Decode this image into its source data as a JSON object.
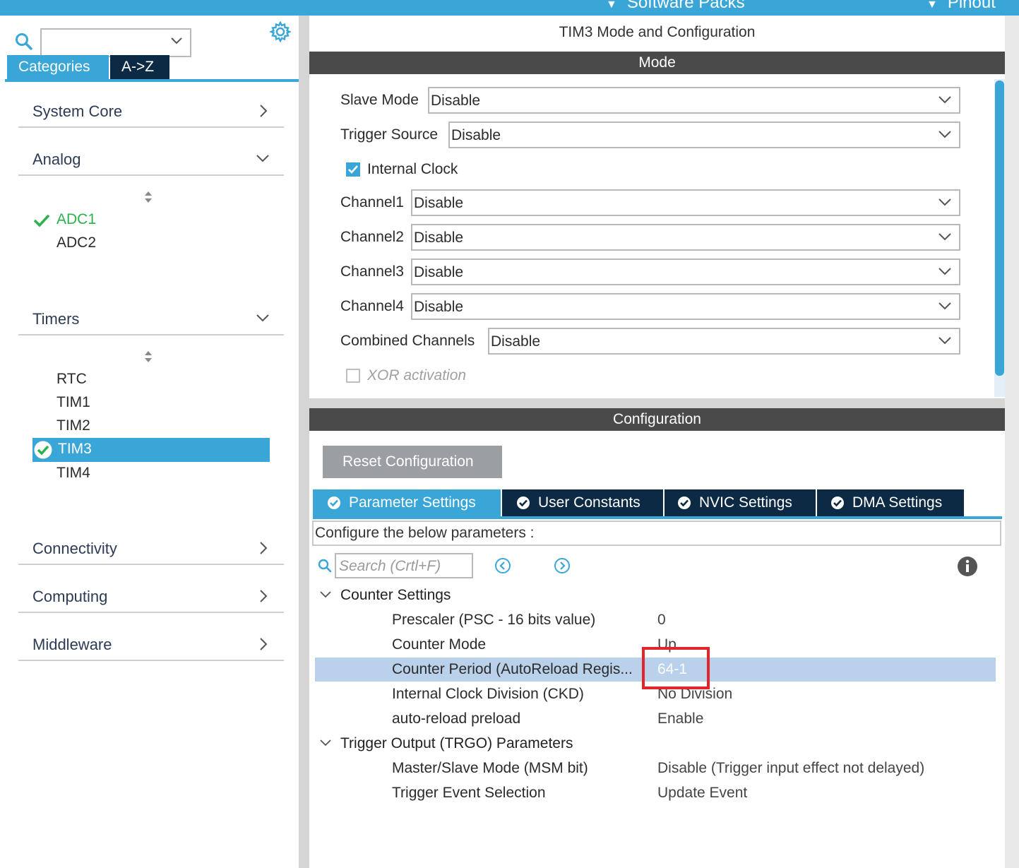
{
  "topbar": {
    "software_packs": "Software Packs",
    "pinout": "Pinout"
  },
  "left_panel": {
    "search": {
      "value": ""
    },
    "tabs": {
      "categories": "Categories",
      "az": "A->Z"
    },
    "categories": [
      {
        "label": "System Core",
        "state": "collapsed"
      },
      {
        "label": "Analog",
        "state": "expanded"
      },
      {
        "label": "Timers",
        "state": "expanded"
      },
      {
        "label": "Connectivity",
        "state": "collapsed"
      },
      {
        "label": "Computing",
        "state": "collapsed"
      },
      {
        "label": "Middleware",
        "state": "collapsed"
      }
    ],
    "analog_items": [
      "ADC1",
      "ADC2"
    ],
    "timer_items": [
      "RTC",
      "TIM1",
      "TIM2",
      "TIM3",
      "TIM4"
    ],
    "selected_item": "TIM3",
    "enabled_color": "#2bb24c",
    "accent": "#3aa6d8"
  },
  "right_panel": {
    "title": "TIM3 Mode and Configuration",
    "mode_header": "Mode",
    "mode_rows": [
      {
        "label": "Slave Mode",
        "value": "Disable"
      },
      {
        "label": "Trigger Source",
        "value": "Disable"
      },
      {
        "label": "Channel1",
        "value": "Disable"
      },
      {
        "label": "Channel2",
        "value": "Disable"
      },
      {
        "label": "Channel3",
        "value": "Disable"
      },
      {
        "label": "Channel4",
        "value": "Disable"
      },
      {
        "label": "Combined Channels",
        "value": "Disable"
      }
    ],
    "internal_clock": {
      "label": "Internal Clock",
      "checked": true
    },
    "xor_activation": {
      "label": "XOR activation",
      "checked": false,
      "disabled": true
    },
    "config_header": "Configuration",
    "reset_button": "Reset Configuration",
    "tabs": [
      {
        "label": "Parameter Settings",
        "active": true
      },
      {
        "label": "User Constants",
        "active": false
      },
      {
        "label": "NVIC Settings",
        "active": false
      },
      {
        "label": "DMA Settings",
        "active": false
      }
    ],
    "configure_text": "Configure the below parameters :",
    "search_placeholder": "Search (Crtl+F)",
    "groups": [
      {
        "label": "Counter Settings",
        "params": [
          {
            "name": "Prescaler (PSC - 16 bits value)",
            "value": "0"
          },
          {
            "name": "Counter Mode",
            "value": "Up"
          },
          {
            "name": "Counter Period (AutoReload Regis...",
            "value": "64-1"
          },
          {
            "name": "Internal Clock Division (CKD)",
            "value": "No Division"
          },
          {
            "name": "auto-reload preload",
            "value": "Enable"
          }
        ]
      },
      {
        "label": "Trigger Output (TRGO) Parameters",
        "params": [
          {
            "name": "Master/Slave Mode (MSM bit)",
            "value": "Disable (Trigger input effect not delayed)"
          },
          {
            "name": "Trigger Event Selection",
            "value": "Update Event"
          }
        ]
      }
    ],
    "highlight_color": "#e3242b"
  }
}
